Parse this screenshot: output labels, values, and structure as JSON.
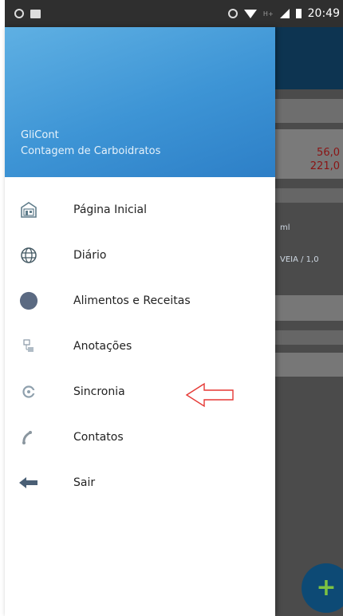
{
  "status_bar": {
    "time": "20:49",
    "network": "H+"
  },
  "drawer": {
    "app_name": "GliCont",
    "app_subtitle": "Contagem de Carboidratos",
    "header_color": "#3d94d5",
    "items": [
      {
        "label": "Página Inicial",
        "icon": "home-icon"
      },
      {
        "label": "Diário",
        "icon": "globe-icon"
      },
      {
        "label": "Alimentos e Receitas",
        "icon": "circle-icon"
      },
      {
        "label": "Anotações",
        "icon": "notes-icon"
      },
      {
        "label": "Sincronia",
        "icon": "sync-icon"
      },
      {
        "label": "Contatos",
        "icon": "phone-icon"
      },
      {
        "label": "Sair",
        "icon": "arrow-left-icon"
      }
    ]
  },
  "background_app": {
    "value_1": "56,0",
    "value_2": "221,0",
    "text_1": "ml",
    "text_2": "VEIA / 1,0",
    "fab_label": "+",
    "toolbar_color": "#0d3451"
  }
}
